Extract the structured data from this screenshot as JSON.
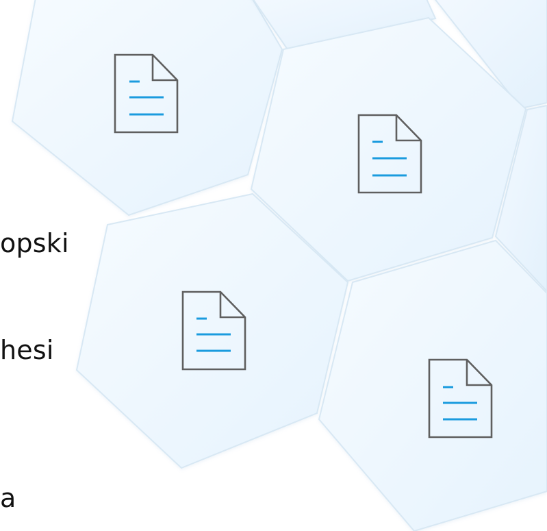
{
  "text_fragments": [
    "opski",
    "hesi",
    "a"
  ],
  "colors": {
    "hex_fill_light": "#f1f8fe",
    "hex_fill_mid": "#e9f4fd",
    "hex_edge": "#d8e8f4",
    "icon_outline": "#5f5f5f",
    "icon_lines": "#1a9bde",
    "text": "#111111"
  },
  "icons": [
    "document-icon",
    "document-icon",
    "document-icon",
    "document-icon"
  ]
}
